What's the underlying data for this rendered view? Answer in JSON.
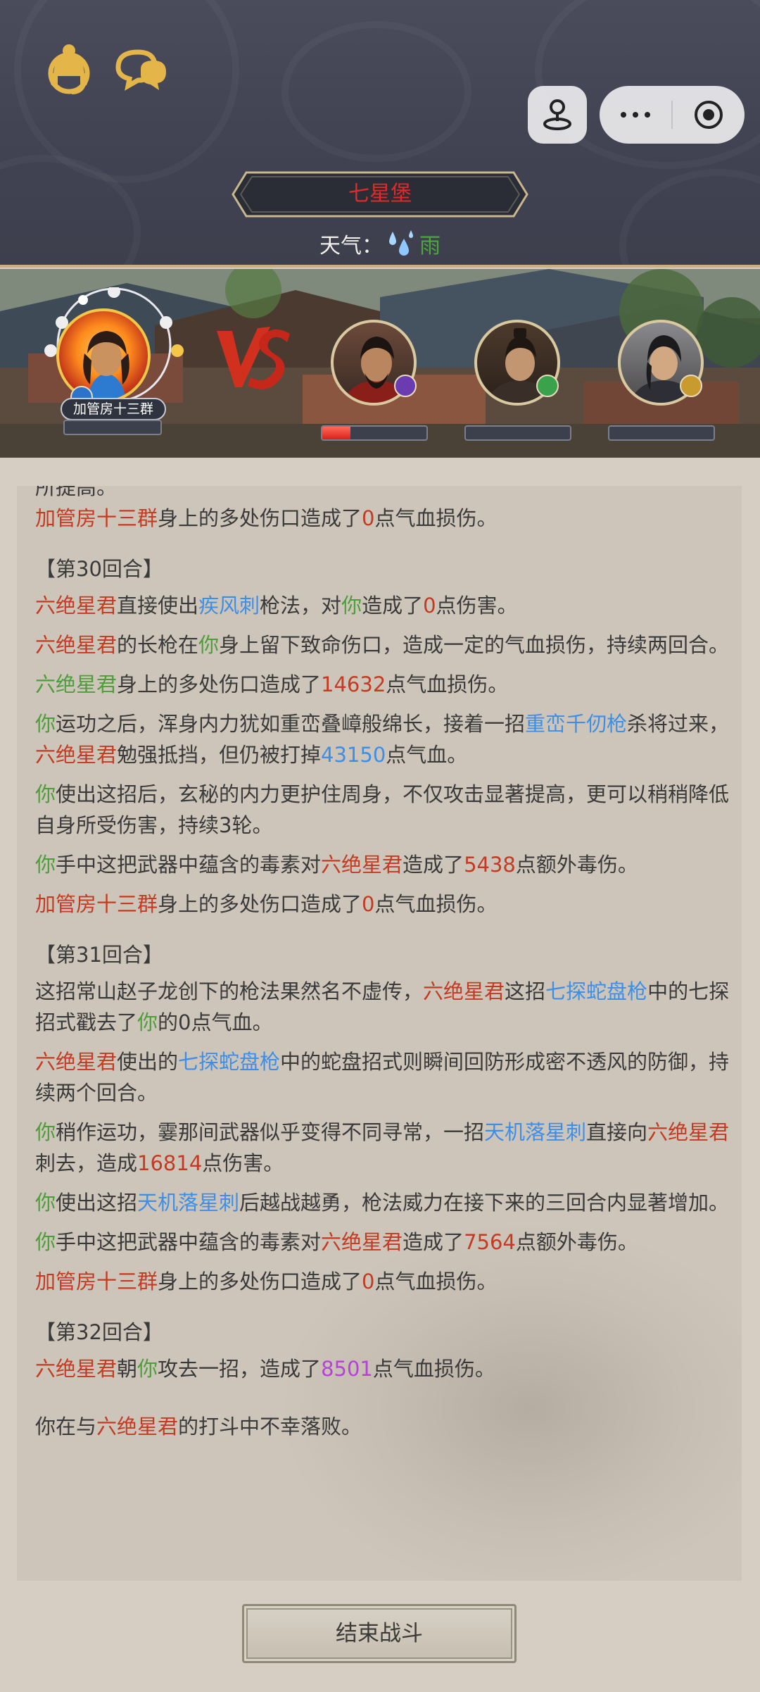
{
  "header": {
    "location": "七星堡",
    "weather_label": "天气：",
    "weather_value": "雨",
    "icons": [
      "customer-service-icon",
      "chat-icon",
      "joystick-icon",
      "more-icon",
      "target-icon"
    ]
  },
  "battle": {
    "player_name": "加管房十三群",
    "enemies": [
      {
        "hp_fraction": 0.27
      },
      {
        "hp_fraction": 0
      },
      {
        "hp_fraction": 0
      }
    ],
    "vs_label": "VS"
  },
  "log": {
    "clipped_line": "所提高。",
    "line_1": [
      {
        "t": "加管房十三群",
        "c": "red"
      },
      {
        "t": "身上的多处伤口造成了",
        "c": ""
      },
      {
        "t": "0",
        "c": "red"
      },
      {
        "t": "点气血损伤。",
        "c": ""
      }
    ],
    "round_30": "【第30回合】",
    "r30": [
      [
        {
          "t": "六绝星君",
          "c": "red"
        },
        {
          "t": "直接使出",
          "c": ""
        },
        {
          "t": "疾风刺",
          "c": "blue"
        },
        {
          "t": "枪法，对",
          "c": ""
        },
        {
          "t": "你",
          "c": "green"
        },
        {
          "t": "造成了",
          "c": ""
        },
        {
          "t": "0",
          "c": "red"
        },
        {
          "t": "点伤害。",
          "c": ""
        }
      ],
      [
        {
          "t": "六绝星君",
          "c": "red"
        },
        {
          "t": "的长枪在",
          "c": ""
        },
        {
          "t": "你",
          "c": "green"
        },
        {
          "t": "身上留下致命伤口，造成一定的气血损伤，持续两回合。",
          "c": ""
        }
      ],
      [
        {
          "t": "六绝星君",
          "c": "green"
        },
        {
          "t": "身上的多处伤口造成了",
          "c": ""
        },
        {
          "t": "14632",
          "c": "red"
        },
        {
          "t": "点气血损伤。",
          "c": ""
        }
      ],
      [
        {
          "t": "你",
          "c": "green"
        },
        {
          "t": "运功之后，浑身内力犹如重峦叠嶂般绵长，接着一招",
          "c": ""
        },
        {
          "t": "重峦千仞枪",
          "c": "blue"
        },
        {
          "t": "杀将过来，",
          "c": ""
        },
        {
          "t": "六绝星君",
          "c": "red"
        },
        {
          "t": "勉强抵挡，但仍被打掉",
          "c": ""
        },
        {
          "t": "43150",
          "c": "blue"
        },
        {
          "t": "点气血。",
          "c": ""
        }
      ],
      [
        {
          "t": "你",
          "c": "green"
        },
        {
          "t": "使出这招后，玄秘的内力更护住周身，不仅攻击显著提高，更可以稍稍降低自身所受伤害，持续3轮。",
          "c": ""
        }
      ],
      [
        {
          "t": "你",
          "c": "green"
        },
        {
          "t": "手中这把武器中蕴含的毒素对",
          "c": ""
        },
        {
          "t": "六绝星君",
          "c": "red"
        },
        {
          "t": "造成了",
          "c": ""
        },
        {
          "t": "5438",
          "c": "red"
        },
        {
          "t": "点额外毒伤。",
          "c": ""
        }
      ],
      [
        {
          "t": "加管房十三群",
          "c": "red"
        },
        {
          "t": "身上的多处伤口造成了",
          "c": ""
        },
        {
          "t": "0",
          "c": "red"
        },
        {
          "t": "点气血损伤。",
          "c": ""
        }
      ]
    ],
    "round_31": "【第31回合】",
    "r31": [
      [
        {
          "t": "这招常山赵子龙创下的枪法果然名不虚传，",
          "c": ""
        },
        {
          "t": "六绝星君",
          "c": "red"
        },
        {
          "t": "这招",
          "c": ""
        },
        {
          "t": "七探蛇盘枪",
          "c": "blue"
        },
        {
          "t": "中的七探招式戳去了",
          "c": ""
        },
        {
          "t": "你",
          "c": "green"
        },
        {
          "t": "的0点气血。",
          "c": ""
        }
      ],
      [
        {
          "t": "六绝星君",
          "c": "red"
        },
        {
          "t": "使出的",
          "c": ""
        },
        {
          "t": "七探蛇盘枪",
          "c": "blue"
        },
        {
          "t": "中的蛇盘招式则瞬间回防形成密不透风的防御，持续两个回合。",
          "c": ""
        }
      ],
      [
        {
          "t": "你",
          "c": "green"
        },
        {
          "t": "稍作运功，霎那间武器似乎变得不同寻常，一招",
          "c": ""
        },
        {
          "t": "天机落星刺",
          "c": "blue"
        },
        {
          "t": "直接向",
          "c": ""
        },
        {
          "t": "六绝星君",
          "c": "red"
        },
        {
          "t": "刺去，造成",
          "c": ""
        },
        {
          "t": "16814",
          "c": "red"
        },
        {
          "t": "点伤害。",
          "c": ""
        }
      ],
      [
        {
          "t": "你",
          "c": "green"
        },
        {
          "t": "使出这招",
          "c": ""
        },
        {
          "t": "天机落星刺",
          "c": "blue"
        },
        {
          "t": "后越战越勇，枪法威力在接下来的三回合内显著增加。",
          "c": ""
        }
      ],
      [
        {
          "t": "你",
          "c": "green"
        },
        {
          "t": "手中这把武器中蕴含的毒素对",
          "c": ""
        },
        {
          "t": "六绝星君",
          "c": "red"
        },
        {
          "t": "造成了",
          "c": ""
        },
        {
          "t": "7564",
          "c": "red"
        },
        {
          "t": "点额外毒伤。",
          "c": ""
        }
      ],
      [
        {
          "t": "加管房十三群",
          "c": "red"
        },
        {
          "t": "身上的多处伤口造成了",
          "c": ""
        },
        {
          "t": "0",
          "c": "red"
        },
        {
          "t": "点气血损伤。",
          "c": ""
        }
      ]
    ],
    "round_32": "【第32回合】",
    "r32": [
      [
        {
          "t": "六绝星君",
          "c": "red"
        },
        {
          "t": "朝",
          "c": ""
        },
        {
          "t": "你",
          "c": "green"
        },
        {
          "t": "攻去一招，造成了",
          "c": ""
        },
        {
          "t": "8501",
          "c": "purple"
        },
        {
          "t": "点气血损伤。",
          "c": ""
        }
      ]
    ],
    "ending": [
      {
        "t": "你在与",
        "c": ""
      },
      {
        "t": "六绝星君",
        "c": "red"
      },
      {
        "t": "的打斗中不幸落败。",
        "c": ""
      }
    ]
  },
  "footer": {
    "end_battle_label": "结束战斗"
  },
  "colors": {
    "damage_red": "#c23b22",
    "self_green": "#4d9e3a",
    "skill_blue": "#3f8ee6",
    "crit_purple": "#b642d6",
    "location_red": "#e02a2a"
  }
}
